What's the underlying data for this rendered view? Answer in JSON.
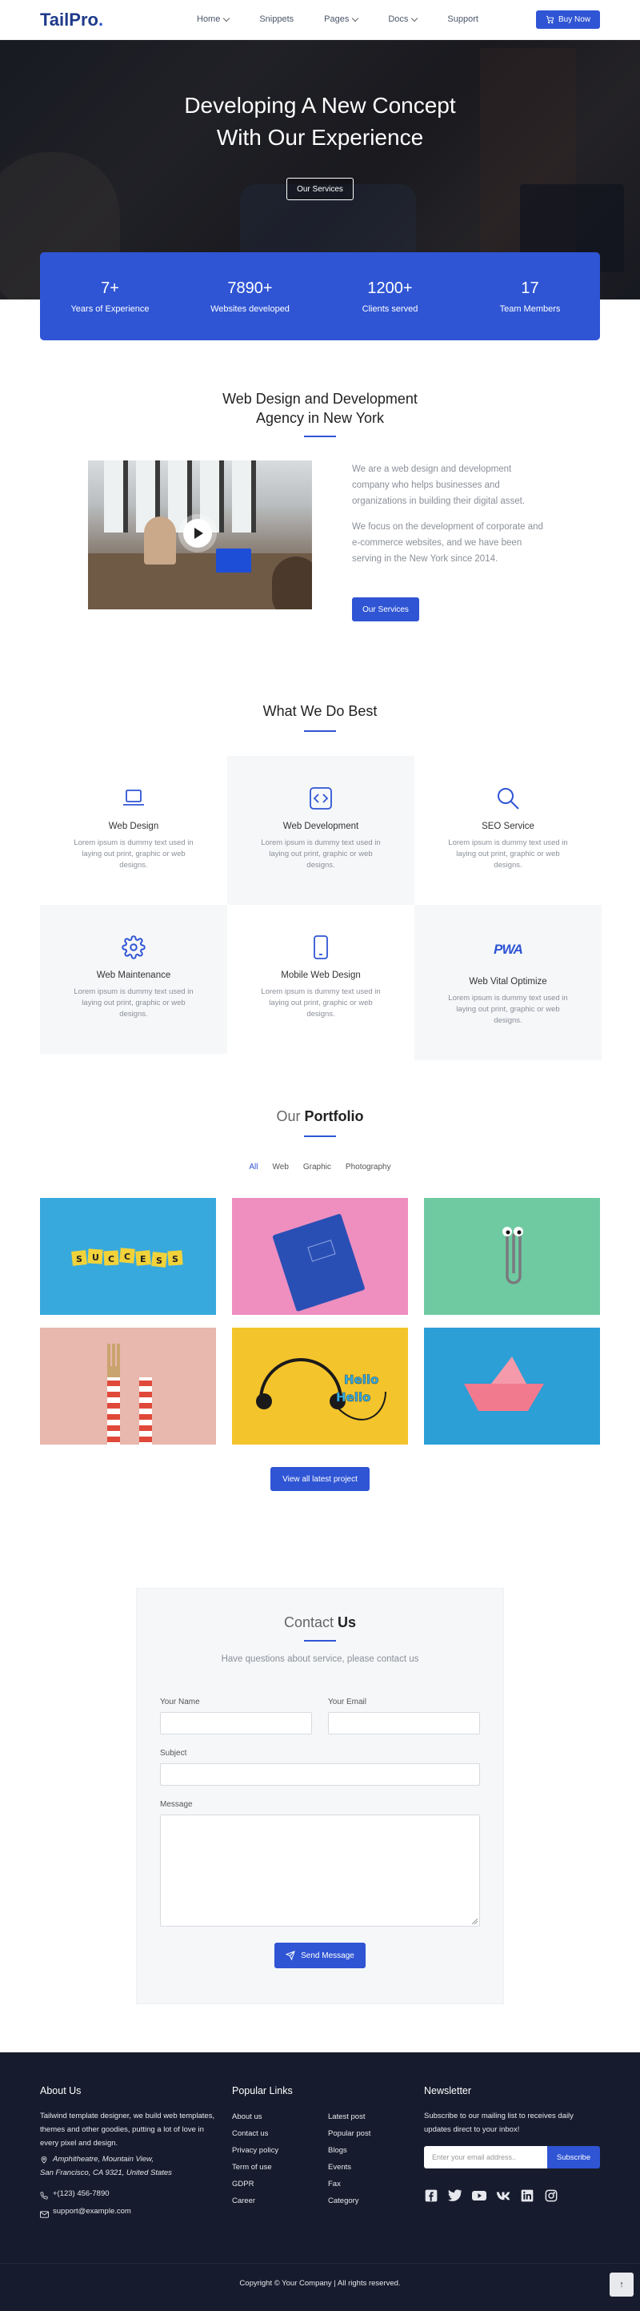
{
  "nav": {
    "logo_main": "TailPro",
    "logo_dot": ".",
    "items": [
      {
        "label": "Home",
        "has_dropdown": true
      },
      {
        "label": "Snippets",
        "has_dropdown": false
      },
      {
        "label": "Pages",
        "has_dropdown": true
      },
      {
        "label": "Docs",
        "has_dropdown": true
      },
      {
        "label": "Support",
        "has_dropdown": false
      }
    ],
    "buy_label": "Buy Now"
  },
  "hero": {
    "title_line1": "Developing A New Concept",
    "title_line2": "With Our Experience",
    "button_label": "Our Services"
  },
  "stats": [
    {
      "value": "7+",
      "label": "Years of Experience"
    },
    {
      "value": "7890+",
      "label": "Websites developed"
    },
    {
      "value": "1200+",
      "label": "Clients served"
    },
    {
      "value": "17",
      "label": "Team Members"
    }
  ],
  "agency": {
    "title_line1": "Web Design and Development",
    "title_line2": "Agency in New York",
    "para1": "We are a web design and development company who helps businesses and organizations in building their digital asset.",
    "para2": "We focus on the development of corporate and e-commerce websites, and we have been serving in the New York since 2014.",
    "button_label": "Our Services"
  },
  "services": {
    "title": "What We Do Best",
    "items": [
      {
        "icon": "laptop-icon",
        "title": "Web Design",
        "desc": "Lorem ipsum is dummy text used in laying out print, graphic or web designs."
      },
      {
        "icon": "code-icon",
        "title": "Web Development",
        "desc": "Lorem ipsum is dummy text used in laying out print, graphic or web designs."
      },
      {
        "icon": "search-icon",
        "title": "SEO Service",
        "desc": "Lorem ipsum is dummy text used in laying out print, graphic or web designs."
      },
      {
        "icon": "gear-icon",
        "title": "Web Maintenance",
        "desc": "Lorem ipsum is dummy text used in laying out print, graphic or web designs."
      },
      {
        "icon": "mobile-icon",
        "title": "Mobile Web Design",
        "desc": "Lorem ipsum is dummy text used in laying out print, graphic or web designs."
      },
      {
        "icon": "pwa-icon",
        "icon_text": "PWA",
        "title": "Web Vital Optimize",
        "desc": "Lorem ipsum is dummy text used in laying out print, graphic or web designs."
      }
    ]
  },
  "portfolio": {
    "title_light": "Our",
    "title_bold": "Portfolio",
    "filters": [
      "All",
      "Web",
      "Graphic",
      "Photography"
    ],
    "active_filter": "All",
    "tiles": [
      {
        "subject": "success-blocks",
        "letters": [
          "S",
          "U",
          "C",
          "C",
          "E",
          "S",
          "S"
        ]
      },
      {
        "subject": "blue-notebook"
      },
      {
        "subject": "paperclip"
      },
      {
        "subject": "fork"
      },
      {
        "subject": "headphones",
        "text": "Hello"
      },
      {
        "subject": "paper-boat"
      }
    ],
    "button_label": "View all latest project"
  },
  "contact": {
    "title_light": "Contact",
    "title_bold": "Us",
    "subtitle": "Have questions about service, please contact us",
    "name_label": "Your Name",
    "email_label": "Your Email",
    "subject_label": "Subject",
    "message_label": "Message",
    "send_label": "Send Message"
  },
  "footer": {
    "about_title": "About Us",
    "about_text": "Tailwind template designer, we build web templates, themes and other goodies, putting a lot of love in every pixel and design.",
    "address_line1": "Amphitheatre, Mountain View,",
    "address_line2": "San Francisco, CA 9321, United States",
    "phone": "+(123) 456-7890",
    "email": "support@example.com",
    "links_title": "Popular Links",
    "links_col1": [
      "About us",
      "Contact us",
      "Privacy policy",
      "Term of use",
      "GDPR",
      "Career"
    ],
    "links_col2": [
      "Latest post",
      "Popular post",
      "Blogs",
      "Events",
      "Fax",
      "Category"
    ],
    "newsletter_title": "Newsletter",
    "newsletter_text": "Subscribe to our mailing list to receives daily updates direct to your inbox!",
    "newsletter_placeholder": "Enter your email address..",
    "subscribe_label": "Subscribe",
    "social": [
      "facebook-icon",
      "twitter-icon",
      "youtube-icon",
      "vk-icon",
      "linkedin-icon",
      "instagram-icon"
    ],
    "copyright": "Copyright © Your Company | All rights reserved."
  },
  "colors": {
    "primary": "#2f55d4",
    "footer_bg": "#161c2d",
    "card_bg": "#f6f7f9"
  }
}
